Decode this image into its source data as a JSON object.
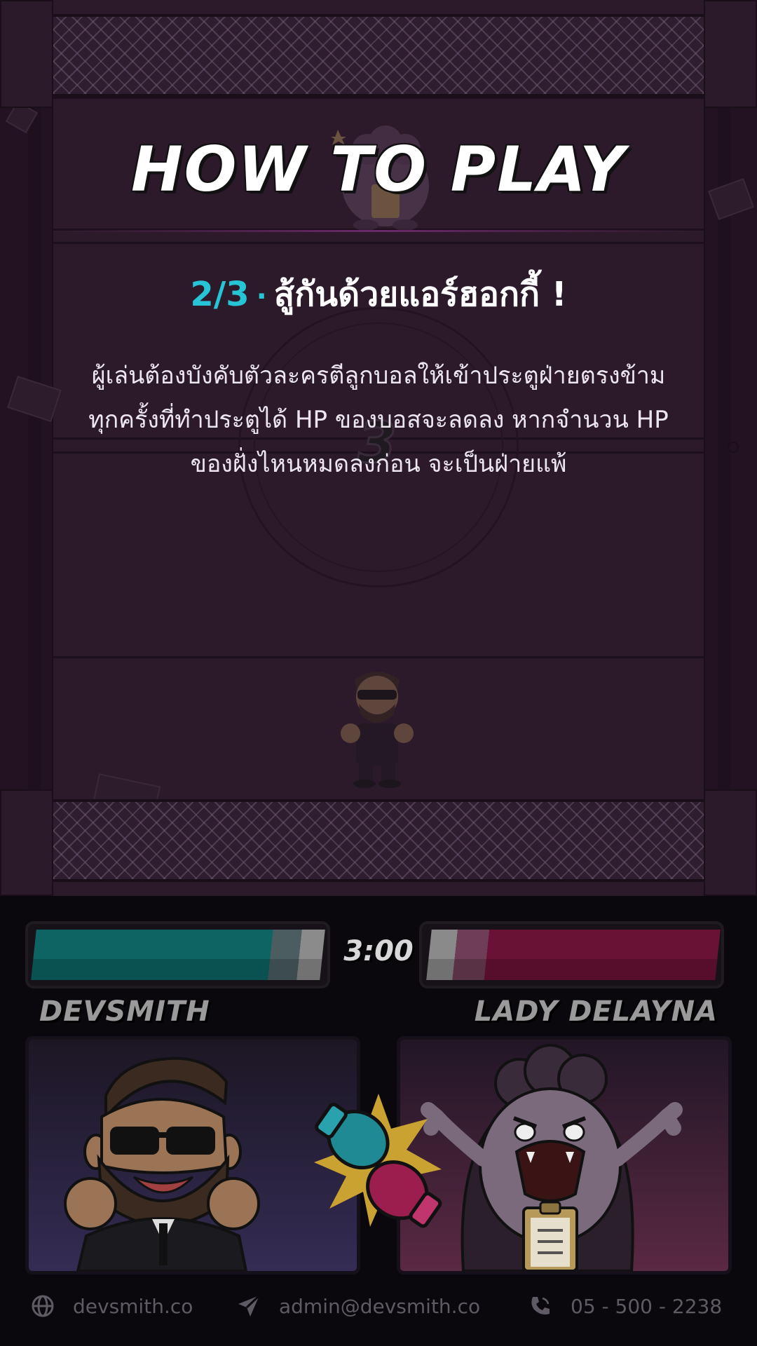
{
  "screen": {
    "title": "HOW TO PLAY",
    "step": {
      "number": "2/3",
      "separator": "·",
      "heading": "สู้กันด้วยแอร์ฮอกกี้ !",
      "body_lines": [
        "ผู้เล่นต้องบังคับตัวละครตีลูกบอลให้เข้าประตูฝ่ายตรงข้าม",
        "ทุกครั้งที่ทำประตูได้ HP ของบอสจะลดลง หากจำนวน HP",
        "ของฝั่งไหนหมดลงก่อน จะเป็นฝ่ายแพ้"
      ]
    },
    "countdown": "3"
  },
  "hud": {
    "timer": "3:00",
    "player_left": {
      "name": "DEVSMITH",
      "hp_percent": 100,
      "color": "#0d6463"
    },
    "player_right": {
      "name": "LADY DELAYNA",
      "hp_percent": 100,
      "color": "#6a1236"
    }
  },
  "footer": {
    "website": {
      "icon": "globe-icon",
      "text": "devsmith.co"
    },
    "email": {
      "icon": "send-icon",
      "text": "admin@devsmith.co"
    },
    "phone": {
      "icon": "phone-icon",
      "text": "05 - 500 - 2238"
    }
  },
  "colors": {
    "accent": "#27c4d6",
    "background": "#2c1a2b",
    "hud_bg": "#0a070d"
  }
}
